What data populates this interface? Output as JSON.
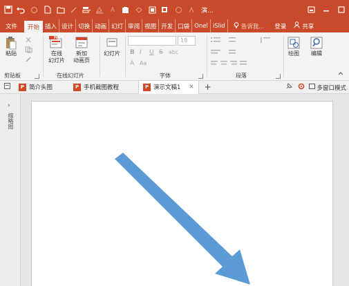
{
  "window": {
    "title": "演...",
    "accent_color": "#c94a2a",
    "quick_access": [
      "save-icon",
      "undo-icon",
      "redo-icon",
      "new-doc-icon",
      "open-icon",
      "format-painter-icon",
      "slide-layout-icon",
      "shape-fill-icon",
      "font-color-icon",
      "picture-icon",
      "shape-outline-icon",
      "arrange-icon",
      "clear-icon",
      "present-icon",
      "print-icon"
    ],
    "controls": [
      "restore-icon",
      "minimize-icon",
      "maximize-icon"
    ]
  },
  "ribbon_tabs": {
    "file": "文件",
    "home": "开始",
    "insert": "插入",
    "design": "设计",
    "transitions": "切换",
    "animations": "动画",
    "slideshow": "幻灯",
    "review": "审阅",
    "view": "视图",
    "developer": "开发",
    "pocket": "口袋",
    "onenote": "Onel",
    "islide": "iSlid",
    "search_placeholder": "告诉我...",
    "login": "登录",
    "share": "共享"
  },
  "ribbon": {
    "clipboard": {
      "paste": "粘贴",
      "label": "剪贴板"
    },
    "online_slides": {
      "online_slide": [
        "在线",
        "幻灯片"
      ],
      "new_animation": [
        "新加",
        "动画页"
      ],
      "badge": "HOT",
      "label": "在线幻灯片"
    },
    "slides": {
      "slide": "幻灯片"
    },
    "font": {
      "size": "18",
      "bold": "B",
      "italic": "I",
      "underline": "U",
      "strike": "S",
      "spacing": "abc",
      "grow": "A",
      "aa": "Aa",
      "label": "字体"
    },
    "paragraph": {
      "label": "段落"
    },
    "drawing": {
      "draw": "绘图"
    },
    "editing": {
      "edit": "编辑"
    }
  },
  "doc_tabs": [
    {
      "label": "简介头图",
      "active": false
    },
    {
      "label": "手机截图教程",
      "active": false
    },
    {
      "label": "演示文稿1",
      "active": true
    }
  ],
  "doc_tab_new": "+",
  "doc_tab_close": "×",
  "multi_window": "多窗口模式",
  "left_pane": {
    "toggle": "›",
    "label": "缩略图"
  },
  "slide": {
    "arrow_color": "#5b9bd5"
  }
}
